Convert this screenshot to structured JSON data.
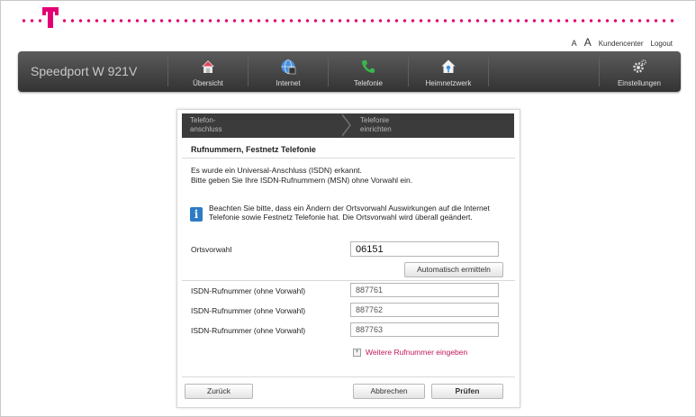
{
  "header": {
    "font_small": "A",
    "font_large": "A",
    "kundencenter": "Kundencenter",
    "logout": "Logout",
    "brand_color": "#e20074"
  },
  "nav": {
    "device": "Speedport W 921V",
    "items": [
      {
        "label": "Übersicht",
        "icon": "home-icon"
      },
      {
        "label": "Internet",
        "icon": "globe-icon"
      },
      {
        "label": "Telefonie",
        "icon": "phone-icon"
      },
      {
        "label": "Heimnetzwerk",
        "icon": "house-network-icon"
      },
      {
        "label": "Einstellungen",
        "icon": "gear-icon"
      }
    ]
  },
  "wizard": {
    "steps": [
      {
        "line1": "Telefon-",
        "line2": "anschluss"
      },
      {
        "line1": "Telefonie",
        "line2": "einrichten"
      }
    ],
    "title": "Rufnummern, Festnetz Telefonie",
    "text_line1": "Es wurde ein Universal-Anschluss (ISDN) erkannt.",
    "text_line2": "Bitte geben Sie Ihre ISDN-Rufnummern (MSN) ohne Vorwahl ein.",
    "info_icon": "i",
    "info_text": "Beachten Sie bitte, dass ein Ändern der Ortsvorwahl Auswirkungen auf die Internet Telefonie sowie Festnetz Telefonie hat. Die Ortsvorwahl wird überall geändert.",
    "ortsvorwahl_label": "Ortsvorwahl",
    "ortsvorwahl_value": "06151",
    "auto_button": "Automatisch ermitteln",
    "isdn_label": "ISDN-Rufnummer (ohne Vorwahl)",
    "isdn_numbers": [
      "887761",
      "887762",
      "887763"
    ],
    "more_link": "Weitere Rufnummer eingeben",
    "more_icon": "+",
    "back_button": "Zurück",
    "cancel_button": "Abbrechen",
    "check_button": "Prüfen"
  }
}
